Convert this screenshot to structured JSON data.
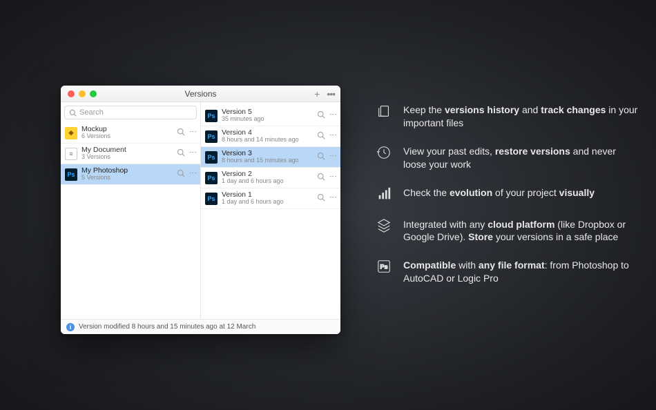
{
  "window": {
    "title": "Versions",
    "search_placeholder": "Search",
    "footer_text": "Version modified 8 hours and 15 minutes ago at 12 March"
  },
  "files": [
    {
      "name": "Mockup",
      "sub": "6 Versions",
      "icon": "sketch",
      "selected": false
    },
    {
      "name": "My Document",
      "sub": "3 Versions",
      "icon": "doc",
      "selected": false
    },
    {
      "name": "My Photoshop",
      "sub": "5 Versions",
      "icon": "ps",
      "selected": true
    }
  ],
  "versions": [
    {
      "name": "Version 5",
      "sub": "35 minutes ago",
      "selected": false
    },
    {
      "name": "Version 4",
      "sub": "8 hours and 14 minutes ago",
      "selected": false
    },
    {
      "name": "Version 3",
      "sub": "8 hours and 15 minutes ago",
      "selected": true
    },
    {
      "name": "Version 2",
      "sub": "1 day and 6 hours ago",
      "selected": false
    },
    {
      "name": "Version 1",
      "sub": "1 day and 6 hours ago",
      "selected": false
    }
  ],
  "features": [
    {
      "icon": "versions",
      "html": "Keep the <b>versions history</b> and <b>track changes</b> in your important files"
    },
    {
      "icon": "restore",
      "html": "View your past edits, <b>restore versions</b> and never loose your work"
    },
    {
      "icon": "chart",
      "html": "Check the <b>evolution</b> of your project <b>visually</b>"
    },
    {
      "icon": "cloud",
      "html": "Integrated with any <b>cloud platform</b> (like Dropbox or Google Drive). <b>Store</b> your versions in a safe place"
    },
    {
      "icon": "compat",
      "html": "<b>Compatible</b> with <b>any file format</b>: from Photoshop to AutoCAD or Logic Pro"
    }
  ]
}
